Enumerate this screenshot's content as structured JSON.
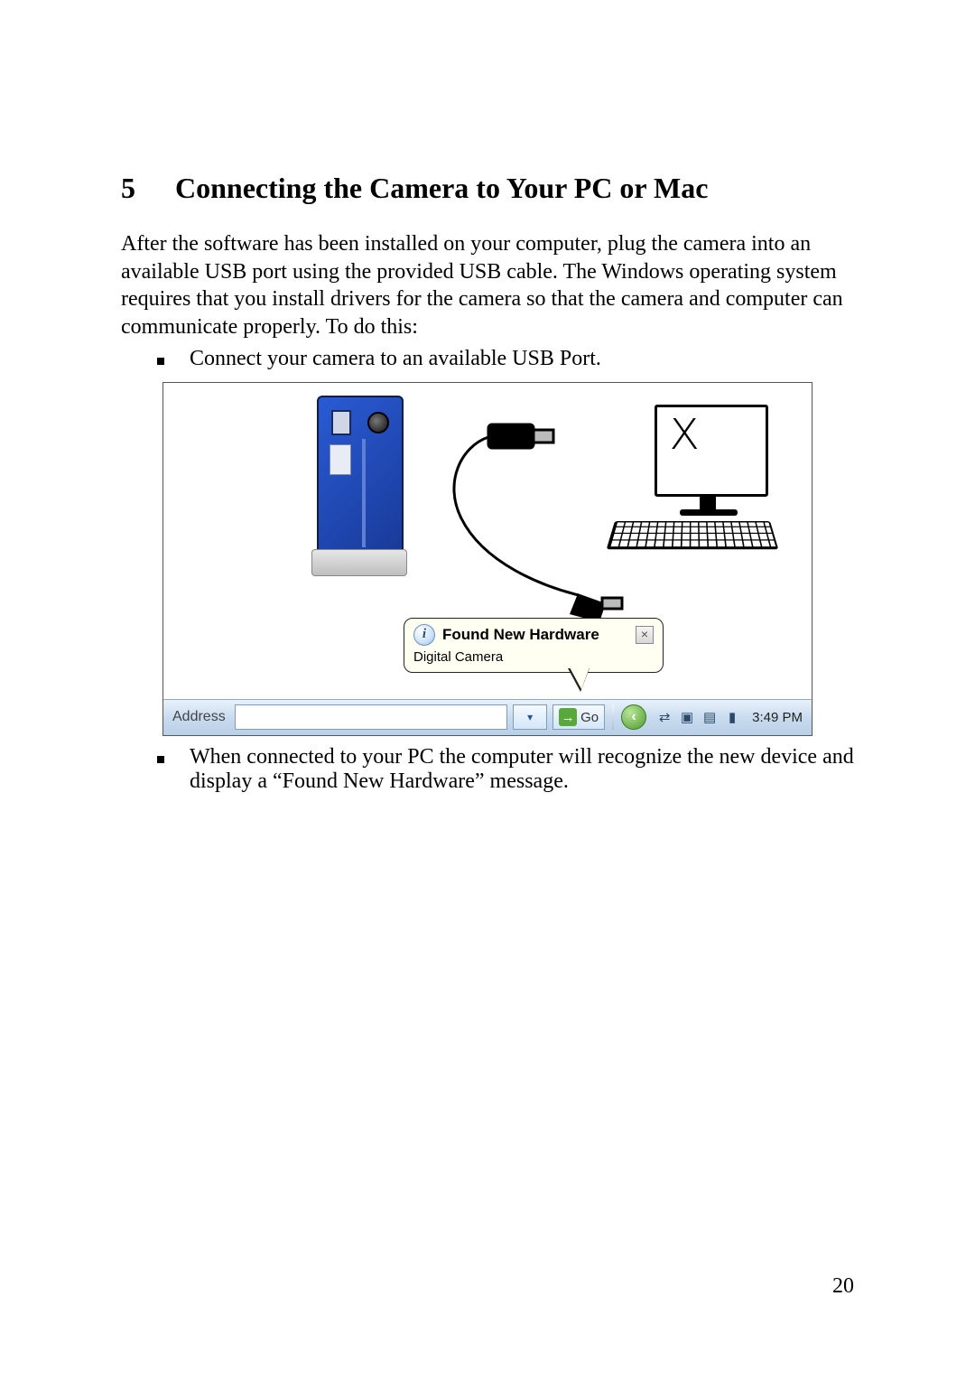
{
  "section_number": "5",
  "section_title": "Connecting the Camera to Your PC or Mac",
  "intro_text": "After the software has been installed on your computer, plug the camera into an available USB port using the provided USB cable.  The Windows operating system requires that you install drivers for the camera so that the camera and computer can communicate properly.  To do this:",
  "bullet_1": "Connect your camera to an available USB Port.",
  "bullet_2": "When connected to your PC the computer will recognize the new device and display a “Found New Hardware” message.",
  "balloon": {
    "title": "Found New Hardware",
    "subtitle": "Digital Camera"
  },
  "taskbar": {
    "address_label": "Address",
    "go_label": "Go",
    "clock": "3:49 PM"
  },
  "page_number": "20"
}
